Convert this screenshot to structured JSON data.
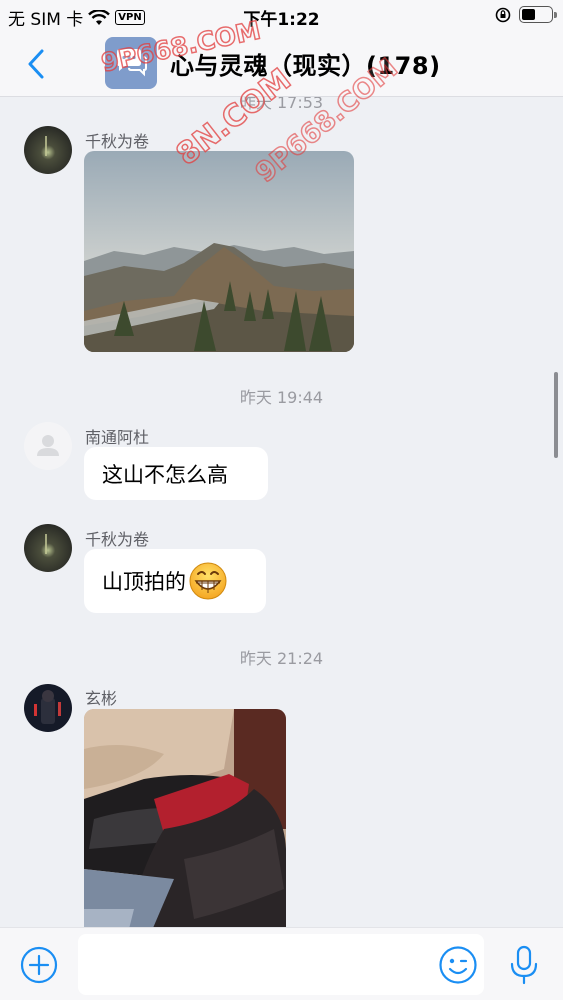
{
  "status_bar": {
    "carrier": "无 SIM 卡",
    "vpn": "VPN",
    "time": "下午1:22"
  },
  "nav": {
    "title": "心与灵魂（现实）(178)"
  },
  "messages": [
    {
      "type": "time",
      "text": "昨天 17:53"
    },
    {
      "type": "image",
      "sender": "千秋为卷",
      "image": "mountain-landscape-photo"
    },
    {
      "type": "time",
      "text": "昨天 19:44"
    },
    {
      "type": "text",
      "sender": "南通阿杜",
      "text": "这山不怎么高"
    },
    {
      "type": "text",
      "sender": "千秋为卷",
      "text": "山顶拍的"
    },
    {
      "type": "time",
      "text": "昨天 21:24"
    },
    {
      "type": "image",
      "sender": "玄彬",
      "image": "stockings-photo"
    }
  ],
  "watermarks": [
    "9P668.COM",
    "8N.COM",
    "9P668.COM"
  ],
  "colors": {
    "accent": "#1a8ef3",
    "chat_bg": "#eef0f4",
    "bar_bg": "#f7f7f9",
    "group_avatar": "#7f9ccb"
  }
}
